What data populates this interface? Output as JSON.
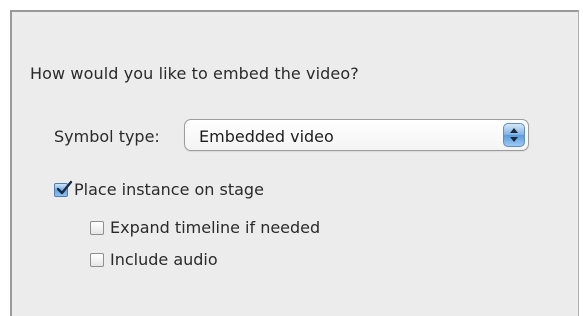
{
  "dialog": {
    "question": "How would you like to embed the video?",
    "symbol_type_label": "Symbol type:",
    "symbol_type_value": "Embedded video",
    "options": [
      {
        "label": "Place instance on stage",
        "checked": true
      },
      {
        "label": "Expand timeline if needed",
        "checked": false
      },
      {
        "label": "Include audio",
        "checked": false
      }
    ]
  },
  "colors": {
    "panel_background": "#ececec",
    "accent": "#6ea8e0"
  }
}
